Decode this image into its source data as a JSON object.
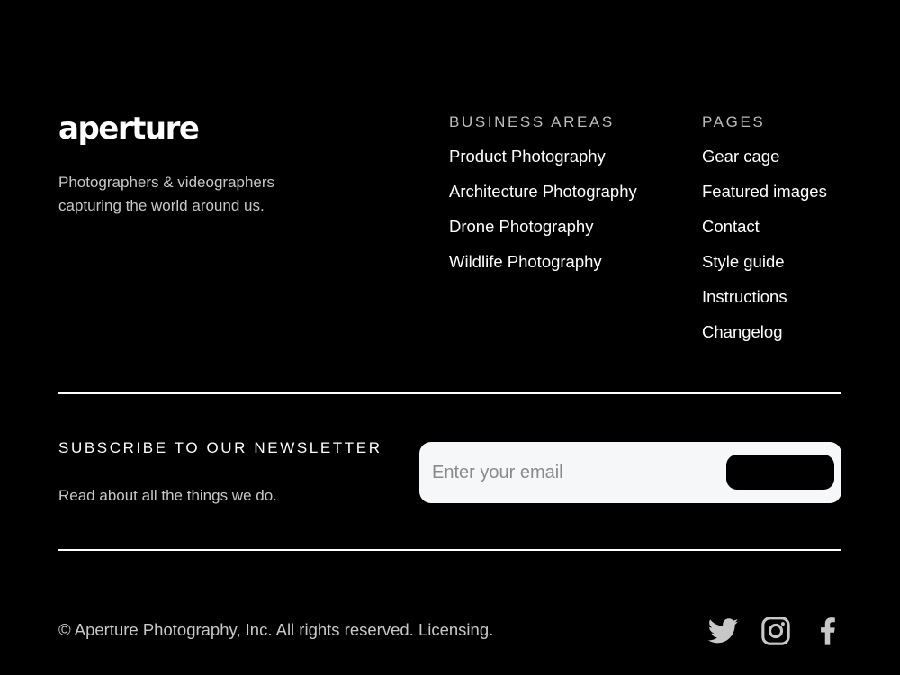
{
  "brand": {
    "logo_text": "aperture",
    "tagline": "Photographers & videographers capturing the world around us."
  },
  "business_areas": {
    "heading": "BUSINESS AREAS",
    "items": [
      "Product Photography",
      "Architecture Photography",
      "Drone Photography",
      "Wildlife Photography"
    ]
  },
  "pages": {
    "heading": "PAGES",
    "items": [
      "Gear cage",
      "Featured images",
      "Contact",
      "Style guide",
      "Instructions",
      "Changelog"
    ]
  },
  "newsletter": {
    "title": "SUBSCRIBE TO OUR NEWSLETTER",
    "subtitle": "Read about all the things we do.",
    "email_placeholder": "Enter your email",
    "email_value": "",
    "button_label": ""
  },
  "footer": {
    "copyright": "© Aperture Photography, Inc. All rights reserved.",
    "licensing_link": "Licensing."
  },
  "social": [
    {
      "icon": "twitter-icon"
    },
    {
      "icon": "instagram-icon"
    },
    {
      "icon": "facebook-icon"
    }
  ],
  "colors": {
    "background": "#000000",
    "text": "#ffffff",
    "muted_text": "#c8c8c8",
    "input_background": "#f6f7f9",
    "button_background": "#000000"
  }
}
